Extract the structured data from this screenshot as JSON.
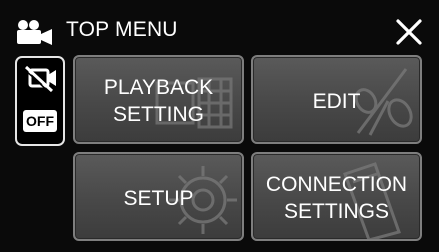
{
  "header": {
    "title": "TOP MENU",
    "camera_icon": "video-camera-icon",
    "close_icon": "close-icon"
  },
  "side_toggle": {
    "icon": "silent-mode-icon",
    "label": "OFF"
  },
  "menu": {
    "items": [
      {
        "label": "PLAYBACK\nSETTING",
        "icon": "film-icon"
      },
      {
        "label": "EDIT",
        "icon": "scissors-icon"
      },
      {
        "label": "SETUP",
        "icon": "gear-icon"
      },
      {
        "label": "CONNECTION\nSETTINGS",
        "icon": "phone-icon"
      }
    ]
  },
  "colors": {
    "background": "#0a0a0a",
    "button_fill": "#4a4a4a",
    "button_border": "#7e7e7e",
    "text": "#ffffff"
  }
}
